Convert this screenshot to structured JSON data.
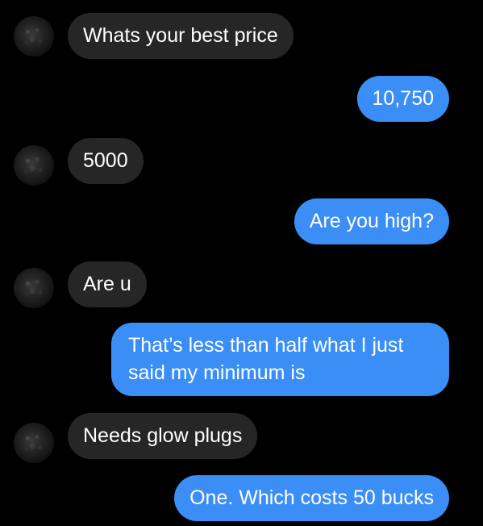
{
  "messages": [
    {
      "direction": "incoming",
      "text": "Whats your best price"
    },
    {
      "direction": "outgoing",
      "text": "10,750"
    },
    {
      "direction": "incoming",
      "text": "5000"
    },
    {
      "direction": "outgoing",
      "text": "Are you high?"
    },
    {
      "direction": "incoming",
      "text": "Are u"
    },
    {
      "direction": "outgoing",
      "text": "That’s less than half what I just said my minimum is"
    },
    {
      "direction": "incoming",
      "text": "Needs glow plugs"
    },
    {
      "direction": "outgoing",
      "text": "One. Which costs 50 bucks"
    }
  ],
  "colors": {
    "background": "#000000",
    "incoming_bubble": "#262626",
    "outgoing_bubble": "#3a8ef6",
    "text": "#ffffff"
  }
}
